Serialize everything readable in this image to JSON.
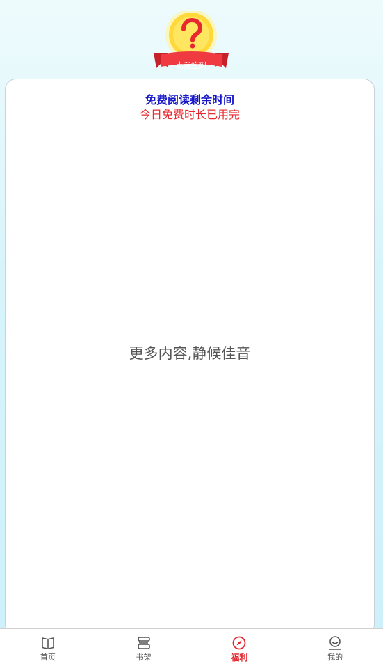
{
  "checkin": {
    "label": "点我签到",
    "icon": "question-medal-icon"
  },
  "card": {
    "title": "免费阅读剩余时间",
    "status": "今日免费时长已用完",
    "placeholder": "更多内容,静候佳音"
  },
  "tabbar": {
    "items": [
      {
        "label": "首页",
        "icon": "book-open-icon",
        "active": false
      },
      {
        "label": "书架",
        "icon": "bookshelf-icon",
        "active": false
      },
      {
        "label": "福利",
        "icon": "compass-icon",
        "active": true
      },
      {
        "label": "我的",
        "icon": "profile-face-icon",
        "active": false
      }
    ]
  },
  "colors": {
    "accent": "#e0252b",
    "title_blue": "#1515c8",
    "status_red": "#e8282e",
    "medal_gold": "#ffd93a",
    "ribbon_red": "#e8343a"
  }
}
